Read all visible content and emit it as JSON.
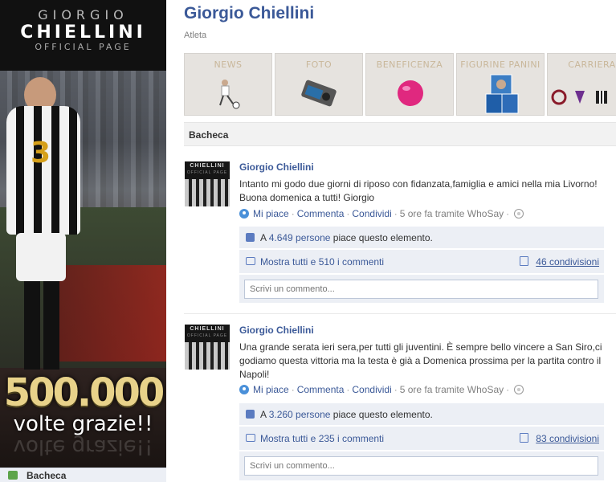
{
  "banner": {
    "brand_line1": "GIORGIO",
    "brand_line2": "CHIELLINI",
    "brand_line3": "OFFICIAL PAGE",
    "jersey_number": "3",
    "milestone": "500.000",
    "thanks": "volte grazie!!"
  },
  "left_nav": {
    "wall_label": "Bacheca"
  },
  "header": {
    "title": "Giorgio Chiellini",
    "category": "Atleta"
  },
  "tabs": [
    {
      "label": "NEWS",
      "icon": "soccer-player-icon"
    },
    {
      "label": "FOTO",
      "icon": "camera-icon"
    },
    {
      "label": "BENEFICENZA",
      "icon": "pink-ball-icon"
    },
    {
      "label": "FIGURINE PANINI",
      "icon": "sticker-cards-icon"
    },
    {
      "label": "CARRIERA",
      "icon": "club-crests-icon"
    }
  ],
  "wall": {
    "heading": "Bacheca"
  },
  "posts": [
    {
      "author": "Giorgio Chiellini",
      "thumb_line1": "CHIELLINI",
      "thumb_line2": "OFFICIAL PAGE",
      "message": "Intanto mi godo due giorni di riposo con fidanzata,famiglia e amici nella mia Livorno! Buona domenica a tutti! Giorgio",
      "like": "Mi piace",
      "comment": "Commenta",
      "share": "Condividi",
      "time": "5 ore fa tramite WhoSay",
      "likes_prefix": "A",
      "likes_count": "4.649 persone",
      "likes_suffix": "piace questo elemento.",
      "show_comments": "Mostra tutti e 510 i commenti",
      "shares": "46 condivisioni",
      "comment_placeholder": "Scrivi un commento..."
    },
    {
      "author": "Giorgio Chiellini",
      "thumb_line1": "CHIELLINI",
      "thumb_line2": "OFFICIAL PAGE",
      "message": "Una grande serata ieri sera,per tutti gli juventini. È sempre bello vincere a San Siro,ci godiamo questa vittoria ma la testa è già a Domenica prossima per la partita contro il Napoli!",
      "like": "Mi piace",
      "comment": "Commenta",
      "share": "Condividi",
      "time": "5 ore fa tramite WhoSay",
      "likes_prefix": "A",
      "likes_count": "3.260 persone",
      "likes_suffix": "piace questo elemento.",
      "show_comments": "Mostra tutti e 235 i commenti",
      "shares": "83 condivisioni",
      "comment_placeholder": "Scrivi un commento..."
    }
  ],
  "colors": {
    "facebook_blue": "#3b5998",
    "ufi_bg": "#eceff5",
    "banner_gold": "#e8d28a"
  }
}
